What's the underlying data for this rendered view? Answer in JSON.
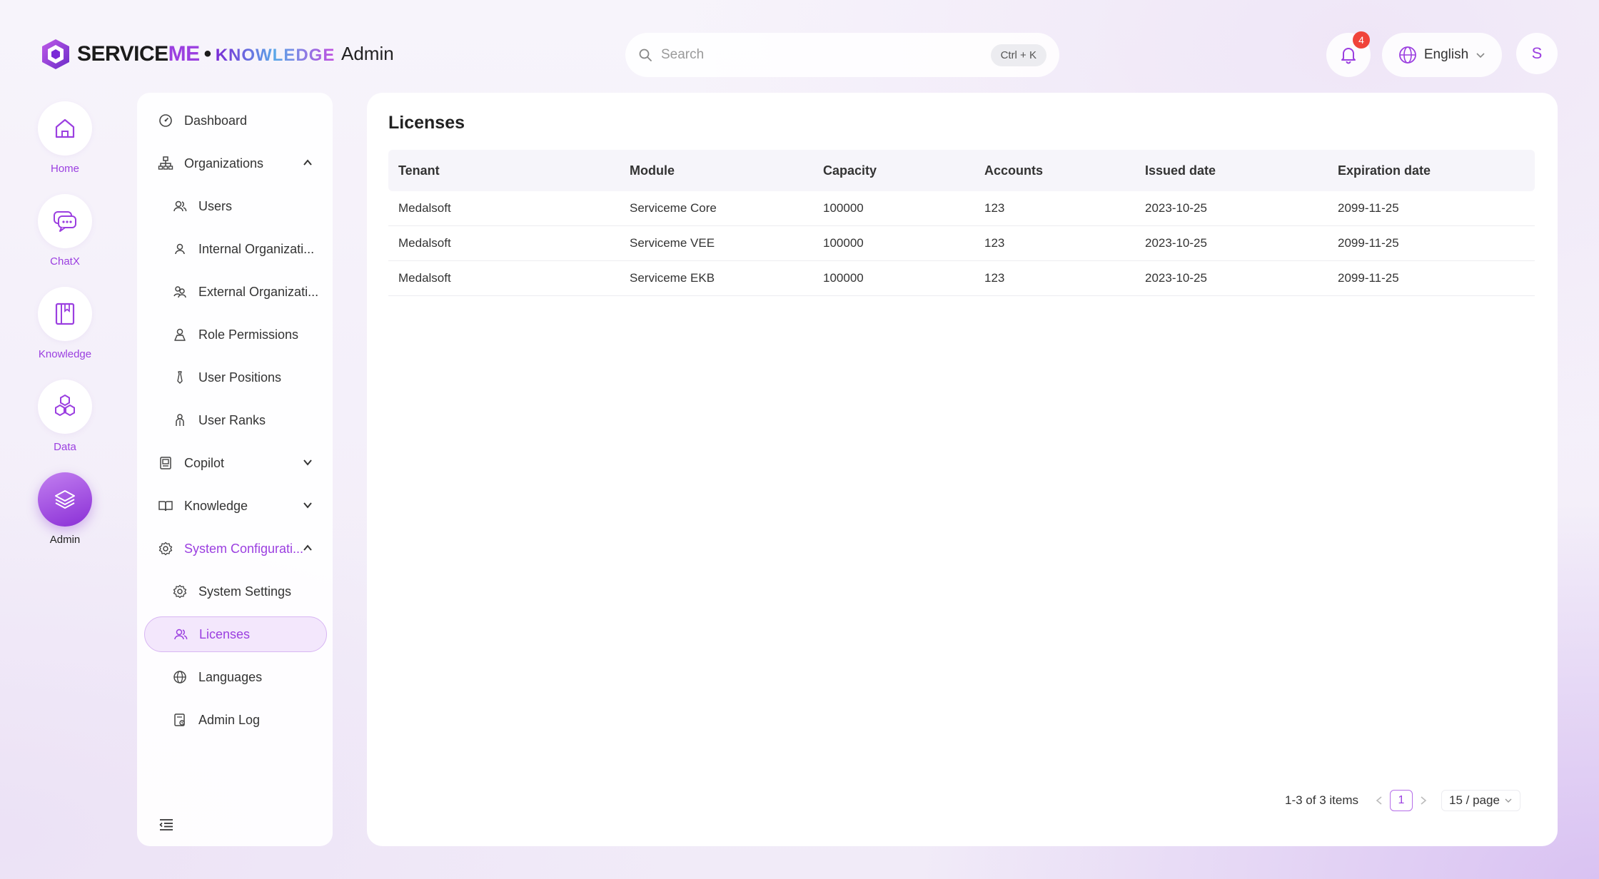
{
  "header": {
    "brand_part1": "SERVICE",
    "brand_part2": "ME",
    "brand_dot": "•",
    "brand_part3": "KNOWLEDGE",
    "section_title": "Admin",
    "search_placeholder": "Search",
    "search_shortcut": "Ctrl + K",
    "notifications_count": "4",
    "language": "English",
    "user_initial": "S"
  },
  "rail": [
    {
      "label": "Home",
      "icon": "home-icon"
    },
    {
      "label": "ChatX",
      "icon": "chat-icon"
    },
    {
      "label": "Knowledge",
      "icon": "book-icon"
    },
    {
      "label": "Data",
      "icon": "hexagons-icon"
    },
    {
      "label": "Admin",
      "icon": "layers-icon",
      "active": true
    }
  ],
  "menu": {
    "dashboard": "Dashboard",
    "organizations": "Organizations",
    "users": "Users",
    "internal_orgs": "Internal Organizati...",
    "external_orgs": "External Organizati...",
    "role_permissions": "Role Permissions",
    "user_positions": "User Positions",
    "user_ranks": "User Ranks",
    "copilot": "Copilot",
    "knowledge": "Knowledge",
    "system_config": "System Configurati...",
    "system_settings": "System Settings",
    "licenses": "Licenses",
    "languages": "Languages",
    "admin_log": "Admin Log"
  },
  "main": {
    "title": "Licenses",
    "columns": [
      "Tenant",
      "Module",
      "Capacity",
      "Accounts",
      "Issued date",
      "Expiration date"
    ],
    "rows": [
      [
        "Medalsoft",
        "Serviceme Core",
        "100000",
        "123",
        "2023-10-25",
        "2099-11-25"
      ],
      [
        "Medalsoft",
        "Serviceme VEE",
        "100000",
        "123",
        "2023-10-25",
        "2099-11-25"
      ],
      [
        "Medalsoft",
        "Serviceme EKB",
        "100000",
        "123",
        "2023-10-25",
        "2099-11-25"
      ]
    ],
    "pagination": {
      "total": "1-3 of 3 items",
      "current_page": "1",
      "page_size": "15 / page"
    }
  },
  "colors": {
    "accent": "#9b3fe0",
    "badge": "#f0443a"
  }
}
